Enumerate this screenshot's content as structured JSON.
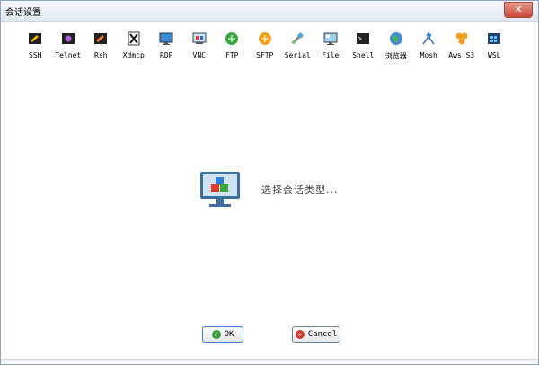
{
  "window": {
    "title": "会话设置",
    "close_label": "✕"
  },
  "toolbar": {
    "items": [
      {
        "label": "SSH",
        "icon": "ssh-icon"
      },
      {
        "label": "Telnet",
        "icon": "telnet-icon"
      },
      {
        "label": "Rsh",
        "icon": "rsh-icon"
      },
      {
        "label": "Xdmcp",
        "icon": "xdmcp-icon"
      },
      {
        "label": "RDP",
        "icon": "rdp-icon"
      },
      {
        "label": "VNC",
        "icon": "vnc-icon"
      },
      {
        "label": "FTP",
        "icon": "ftp-icon"
      },
      {
        "label": "SFTP",
        "icon": "sftp-icon"
      },
      {
        "label": "Serial",
        "icon": "serial-icon"
      },
      {
        "label": "File",
        "icon": "file-icon"
      },
      {
        "label": "Shell",
        "icon": "shell-icon"
      },
      {
        "label": "浏览器",
        "icon": "browser-icon"
      },
      {
        "label": "Mosh",
        "icon": "mosh-icon"
      },
      {
        "label": "Aws S3",
        "icon": "aws-s3-icon"
      },
      {
        "label": "WSL",
        "icon": "wsl-icon"
      }
    ]
  },
  "main": {
    "hint": "选择会话类型..."
  },
  "buttons": {
    "ok_label": "OK",
    "cancel_label": "Cancel"
  },
  "colors": {
    "accent": "#3a7bd5",
    "ok_icon": "#3a9d3a",
    "cancel_icon": "#d33a2c"
  }
}
